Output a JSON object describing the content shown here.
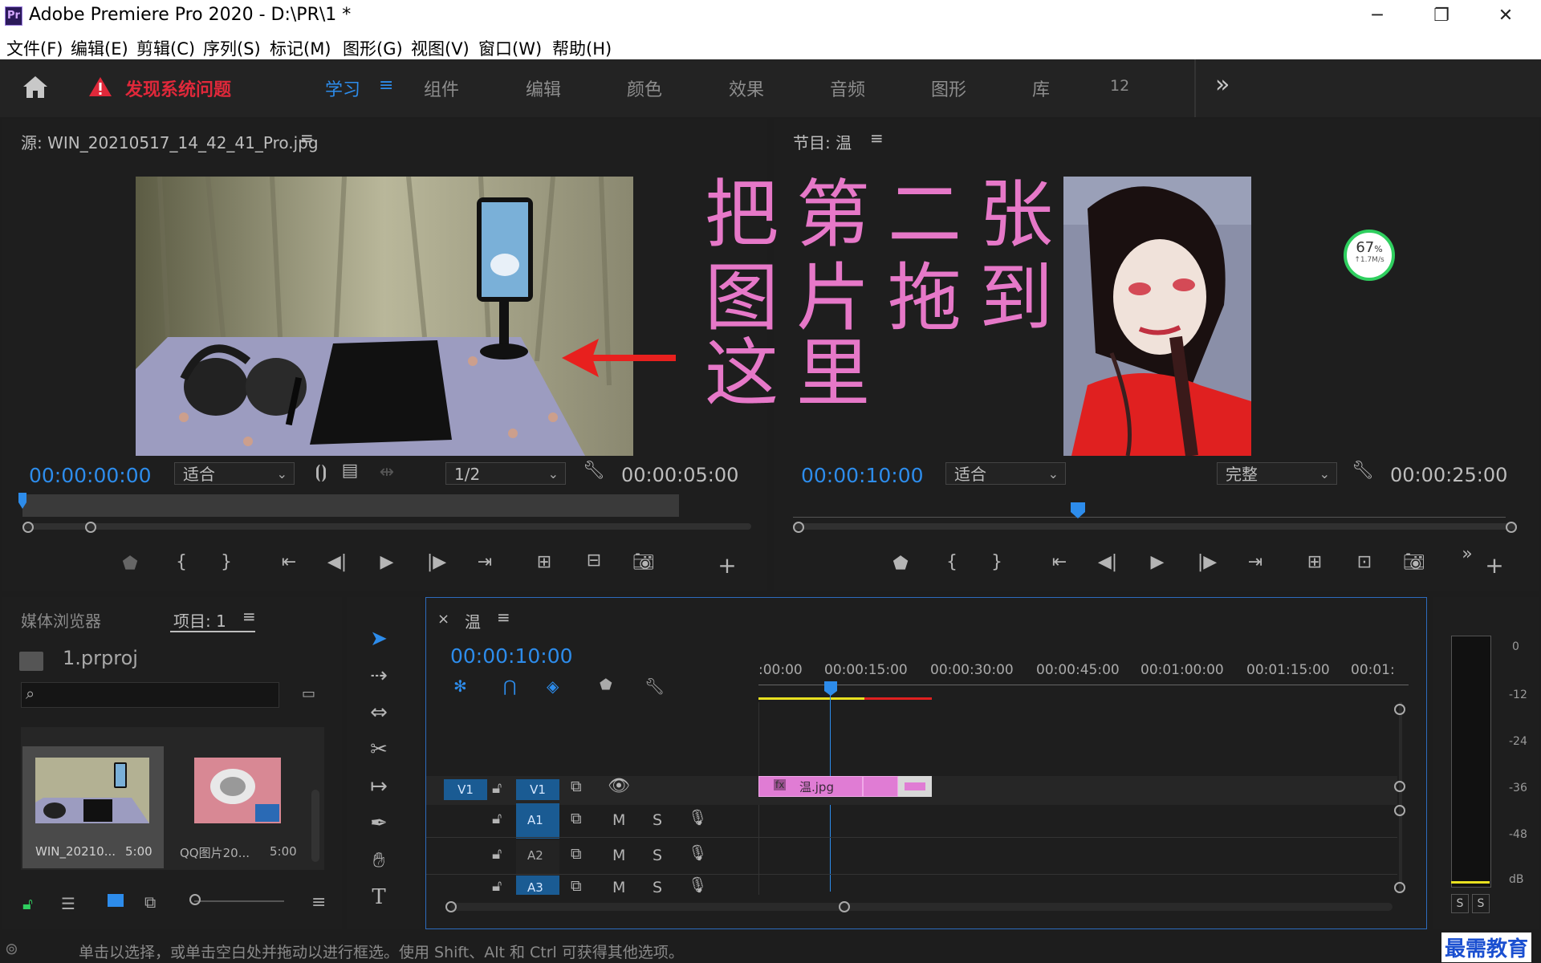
{
  "window": {
    "app_icon": "Pr",
    "title": "Adobe Premiere Pro 2020 - D:\\PR\\1 *",
    "minimize": "─",
    "maximize": "❐",
    "close": "✕"
  },
  "menu": [
    "文件(F)",
    "编辑(E)",
    "剪辑(C)",
    "序列(S)",
    "标记(M)",
    "图形(G)",
    "视图(V)",
    "窗口(W)",
    "帮助(H)"
  ],
  "workspace": {
    "warning": "发现系统问题",
    "active_tab": "学习",
    "tabs": [
      "组件",
      "编辑",
      "颜色",
      "效果",
      "音频",
      "图形",
      "库",
      "12"
    ],
    "overflow": "»"
  },
  "source_monitor": {
    "title": "源: WIN_20210517_14_42_41_Pro.jpg",
    "timecode": "00:00:00:00",
    "fit": "适合",
    "resolution": "1/2",
    "duration": "00:00:05:00"
  },
  "program_monitor": {
    "title": "节目: 温",
    "timecode": "00:00:10:00",
    "fit": "适合",
    "quality": "完整",
    "duration": "00:00:25:00",
    "playhead_fraction": 0.4
  },
  "annotation": {
    "line1": "把第二张",
    "line2": "图片拖到",
    "line3": "这里",
    "color": "#e678c8",
    "arrow_color": "#e8201e"
  },
  "net_widget": {
    "percent": "67",
    "percent_sign": "%",
    "speed": "↑1.7M/s"
  },
  "project_panel": {
    "tab_media": "媒体浏览器",
    "tab_project": "项目: 1",
    "project_file": "1.prproj",
    "items": [
      {
        "name": "WIN_20210...",
        "duration": "5:00"
      },
      {
        "name": "QQ图片20...",
        "duration": "5:00"
      }
    ]
  },
  "timeline": {
    "sequence_name": "温",
    "timecode": "00:00:10:00",
    "ruler_labels": [
      ":00:00",
      "00:00:15:00",
      "00:00:30:00",
      "00:00:45:00",
      "00:01:00:00",
      "00:01:15:00",
      "00:01:"
    ],
    "clip_name": "温.jpg",
    "clip_fx": "fx",
    "tracks": [
      {
        "src": "V1",
        "tgt": "V1"
      },
      {
        "src": "",
        "tgt": "A1",
        "m": "M",
        "s": "S"
      },
      {
        "src": "",
        "tgt": "A2",
        "m": "M",
        "s": "S"
      },
      {
        "src": "",
        "tgt": "A3",
        "m": "M",
        "s": "S"
      }
    ]
  },
  "audio_meter": {
    "labels": [
      "0",
      "-12",
      "-24",
      "-36",
      "-48",
      "dB"
    ],
    "solo_left": "S",
    "solo_right": "S"
  },
  "status": {
    "text": "单击以选择，或单击空白处并拖动以进行框选。使用 Shift、Alt 和 Ctrl 可获得其他选项。"
  },
  "watermark": "最需教育"
}
